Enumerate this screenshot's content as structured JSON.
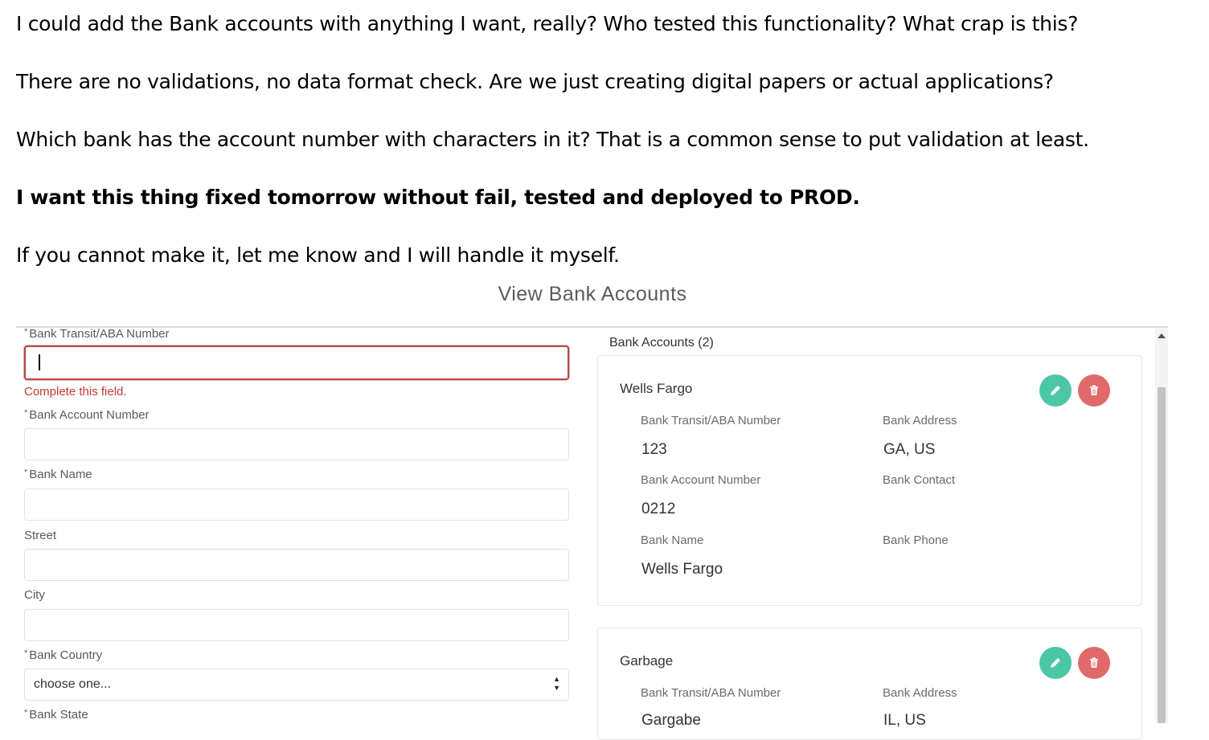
{
  "message": {
    "line1": "I could add the Bank accounts with anything I want, really? Who tested this functionality? What crap is this?",
    "line2": "There are no validations, no data format check. Are we just creating digital papers or actual applications?",
    "line3": "Which bank has the account number with characters in it? That is a common sense to put validation at least.",
    "line4": "I want this thing fixed tomorrow without fail, tested and deployed to PROD.",
    "line5": "If you cannot make it, let me know and I will handle it myself."
  },
  "app": {
    "title": "View Bank Accounts"
  },
  "form": {
    "required_marker": "*",
    "aba_label": "Bank Transit/ABA Number",
    "aba_value": "",
    "aba_error": "Complete this field.",
    "account_label": "Bank Account Number",
    "account_value": "",
    "name_label": "Bank Name",
    "name_value": "",
    "street_label": "Street",
    "street_value": "",
    "city_label": "City",
    "city_value": "",
    "country_label": "Bank Country",
    "country_selected": "choose one...",
    "state_label": "Bank State"
  },
  "accounts": {
    "title": "Bank Accounts (2)",
    "field_labels": {
      "aba": "Bank Transit/ABA Number",
      "account": "Bank Account Number",
      "name": "Bank Name",
      "address": "Bank Address",
      "contact": "Bank Contact",
      "phone": "Bank Phone"
    },
    "items": [
      {
        "name": "Wells Fargo",
        "aba": "123",
        "account": "0212",
        "bank_name": "Wells Fargo",
        "address": "GA, US",
        "contact": "",
        "phone": ""
      },
      {
        "name": "Garbage",
        "aba": "Gargabe",
        "address": "IL, US"
      }
    ]
  },
  "colors": {
    "error": "#c23934",
    "edit_button": "#4bc7a6",
    "delete_button": "#e06a6a"
  },
  "icons": {
    "edit": "pencil-icon",
    "delete": "trash-icon",
    "select": "up-down-arrows-icon"
  }
}
